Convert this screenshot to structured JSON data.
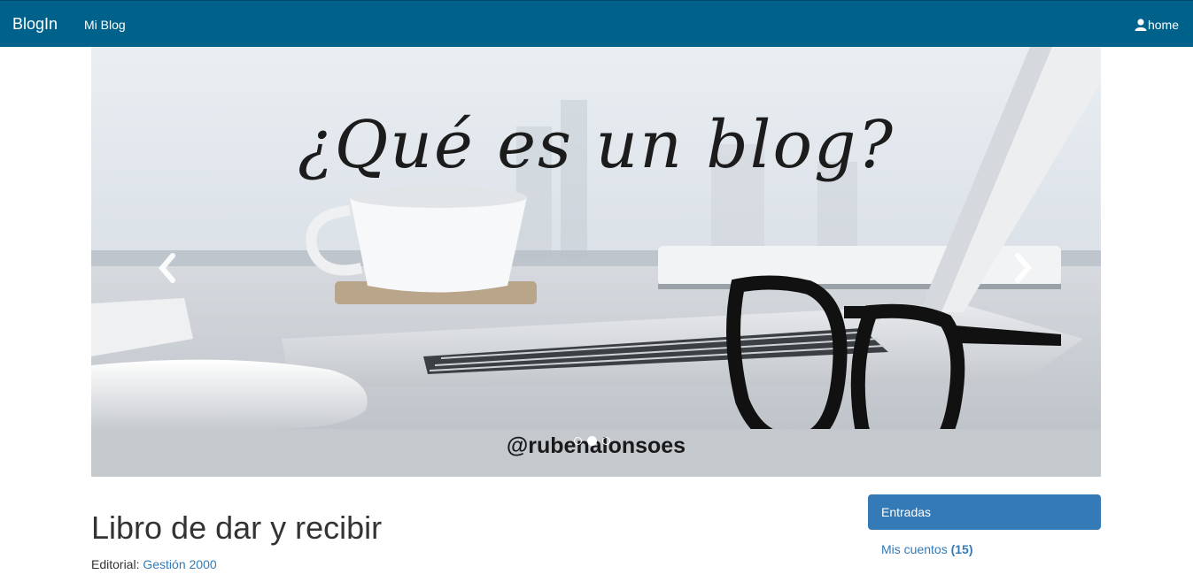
{
  "navbar": {
    "brand": "BlogIn",
    "link": "Mi Blog",
    "user_link": "home",
    "user_icon": "user-icon"
  },
  "carousel": {
    "title": "¿Qué es un blog?",
    "handle": "@rubenalonsoes",
    "prev_icon": "chevron-left-icon",
    "next_icon": "chevron-right-icon",
    "indicator_count": 3,
    "active_indicator": 2
  },
  "post": {
    "title": "Libro de dar y recibir",
    "editorial_label": "Editorial:",
    "editorial_value": "Gestión 2000"
  },
  "sidebar": {
    "panel_title": "Entradas",
    "items": [
      {
        "label": "Mis cuentos",
        "count": "(15)"
      }
    ]
  },
  "colors": {
    "navbar_bg": "#00628b",
    "panel_bg": "#337ab7",
    "link": "#337ab7"
  }
}
